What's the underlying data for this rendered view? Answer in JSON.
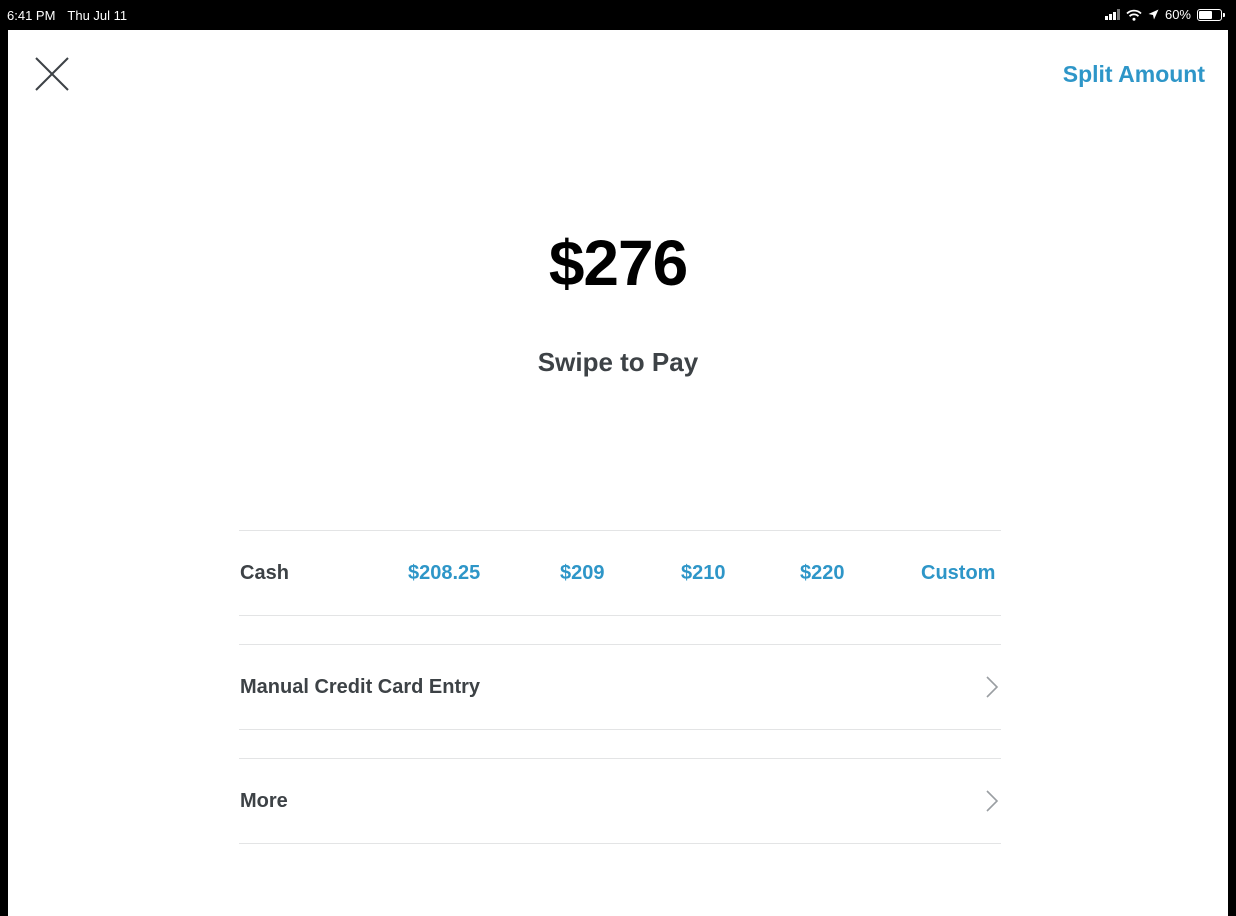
{
  "status_bar": {
    "time": "6:41 PM",
    "date": "Thu Jul 11",
    "battery_text": "60%",
    "battery_level": 0.6
  },
  "header": {
    "close_icon": "close-icon",
    "split_label": "Split Amount"
  },
  "payment": {
    "amount": "$276",
    "swipe_label": "Swipe to Pay"
  },
  "cash": {
    "label": "Cash",
    "options": [
      "$208.25",
      "$209",
      "$210",
      "$220",
      "Custom"
    ]
  },
  "rows": {
    "manual_label": "Manual Credit Card Entry",
    "more_label": "More"
  },
  "colors": {
    "accent": "#2e96c8",
    "text": "#3d4246",
    "divider": "#e3e4e5"
  }
}
